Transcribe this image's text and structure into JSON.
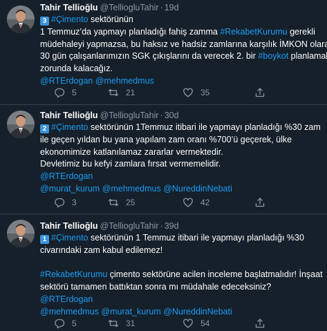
{
  "tweets": [
    {
      "author": {
        "name": "Tahir Tellioğlu",
        "handle": "@TelliogluTahir",
        "separator": "·",
        "time": "19d"
      },
      "lines": [
        [
          {
            "t": "3",
            "badge": true
          },
          {
            "t": "#Çimento",
            "link": true
          },
          {
            "t": " sektörünün"
          }
        ],
        [
          {
            "t": "1 Temmuz’da yapmayı planladığı fahiş zamma "
          },
          {
            "t": "#RekabetKurumu",
            "link": true
          },
          {
            "t": " gerekli"
          }
        ],
        [
          {
            "t": "müdehaleyi yapmazsa, bu haksız ve hadsiz zamlarına karşılık İMKON olarak"
          }
        ],
        [
          {
            "t": "30 gün çalışanlarımızın SGK çıkışlarını da verecek 2. bir "
          },
          {
            "t": "#boykot",
            "link": true
          },
          {
            "t": " planlamak"
          }
        ],
        [
          {
            "t": "zorunda kalacağız."
          }
        ],
        [
          {
            "t": "@RTErdogan @mehmedmus",
            "link": true
          }
        ]
      ],
      "stats": {
        "replies": "5",
        "retweets": "21",
        "likes": "35"
      }
    },
    {
      "author": {
        "name": "Tahir Tellioğlu",
        "handle": "@TelliogluTahir",
        "separator": "·",
        "time": "30d"
      },
      "lines": [
        [
          {
            "t": "2",
            "badge": true
          },
          {
            "t": "#Çimento",
            "link": true
          },
          {
            "t": " sektörünün 1Temmuz itibari ile yapmayı planladığı %30 zam"
          }
        ],
        [
          {
            "t": "ile geçen yıldan bu yana yapılam zam oranı %700’ü geçerek, ülke"
          }
        ],
        [
          {
            "t": "ekonomimize katlanılamaz zararlar vermektedir."
          }
        ],
        [
          {
            "t": "Devletimiz bu kefyi zamlara fırsat vermemelidir."
          }
        ],
        [
          {
            "t": "@RTErdogan",
            "link": true
          }
        ],
        [
          {
            "t": "@murat_kurum @mehmedmus @NureddinNebati",
            "link": true
          }
        ]
      ],
      "stats": {
        "replies": "3",
        "retweets": "25",
        "likes": "42"
      }
    },
    {
      "author": {
        "name": "Tahir Tellioğlu",
        "handle": "@TelliogluTahir",
        "separator": "·",
        "time": "39d"
      },
      "lines": [
        [
          {
            "t": "1",
            "badge": true
          },
          {
            "t": "#Çimento",
            "link": true
          },
          {
            "t": " sektörünün 1 Temmuz itibari ile yapmayı planladığı %30"
          }
        ],
        [
          {
            "t": "civarındaki zam kabul edilemez!"
          }
        ],
        [],
        [
          {
            "t": "#RekabetKurumu",
            "link": true
          },
          {
            "t": " çimento sektörüne acilen inceleme başlatmalıdır! İnşaat"
          }
        ],
        [
          {
            "t": "sektörü tamamen battıktan sonra mı müdahale edeceksiniz?"
          }
        ],
        [
          {
            "t": "@RTErdogan",
            "link": true
          }
        ],
        [
          {
            "t": "@mehmedmus @murat_kurum @NureddinNebati",
            "link": true
          }
        ]
      ],
      "stats": {
        "replies": "5",
        "retweets": "31",
        "likes": "54"
      }
    }
  ],
  "icons": {
    "reply": "reply-icon",
    "retweet": "retweet-icon",
    "like": "like-icon",
    "share": "share-icon",
    "avatar": "profile-photo"
  },
  "colors": {
    "background": "#15202b",
    "link": "#1d9bf0",
    "muted": "#8b98a5",
    "divider": "#38444d",
    "badge": "#3b94d9"
  }
}
